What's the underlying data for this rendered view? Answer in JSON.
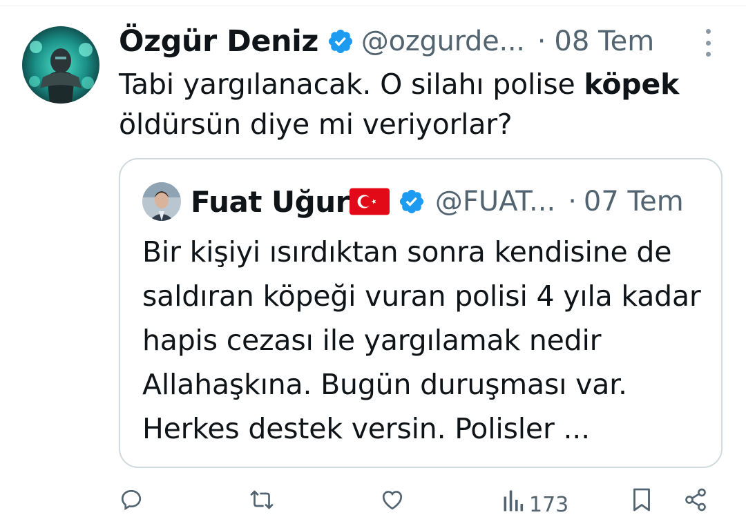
{
  "tweet": {
    "author_name": "Özgür Deniz",
    "handle": "@ozgurde...",
    "separator": "·",
    "date": "08 Tem",
    "text_before": "Tabi yargılanacak. O silahı polise ",
    "text_bold": "köpek",
    "text_after": " öldürsün diye mi veriyorlar?"
  },
  "quote": {
    "author_name": "Fuat Uğur",
    "flag_icon": "turkey-flag",
    "handle": "@FUAT...",
    "separator": "·",
    "date": "07 Tem",
    "text": "Bir kişiyi ısırdıktan sonra kendisine de saldıran köpeği vuran polisi 4 yıla kadar hapis cezası ile yargılamak nedir Allahaşkına. Bugün duruşması var. Herkes destek versin. Polisler ..."
  },
  "actions": {
    "reply_icon": "reply-icon",
    "retweet_icon": "retweet-icon",
    "like_icon": "heart-icon",
    "views_icon": "views-icon",
    "views_count": "173",
    "bookmark_icon": "bookmark-icon",
    "share_icon": "share-icon"
  },
  "colors": {
    "verified": "#1d9bf0",
    "secondary_text": "#536471",
    "border": "#cfd9de"
  }
}
